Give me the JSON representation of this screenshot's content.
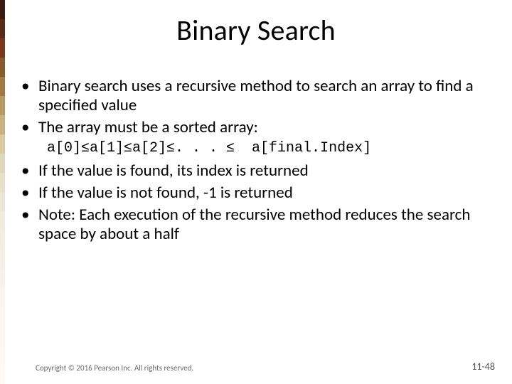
{
  "title": "Binary Search",
  "bullets": [
    "Binary search uses a recursive method to search an array to find a specified value",
    "The array must be a sorted array:"
  ],
  "codeLine": "a[0]≤a[1]≤a[2]≤. . . ≤  a[final.Index]",
  "bullets2": [
    "If the value is found, its index is returned",
    "If the value is not found, -1 is returned",
    "Note:  Each execution of the recursive method reduces the search space by about a half"
  ],
  "footer": "Copyright © 2016 Pearson Inc. All rights reserved.",
  "pageNumber": "11-48",
  "stripeColors": [
    "#3a1a0f",
    "#5a2a14",
    "#7a3a1a",
    "#8a5a2a",
    "#a07a40",
    "#b89a60",
    "#c8b080",
    "#d8c8a0",
    "#e0d8b8",
    "#e8e0c8",
    "#ece6d4",
    "#f0ecdc",
    "#f2eee2",
    "#f4f0e6",
    "#f6f2ea",
    "#f8f4ee",
    "#faf6f0",
    "#fbf8f2",
    "#fcf9f4",
    "#fdfaf6"
  ]
}
